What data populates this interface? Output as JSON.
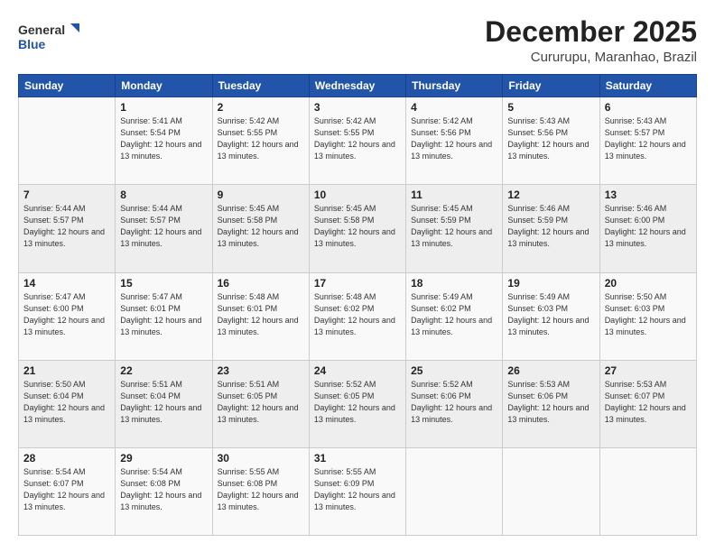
{
  "logo": {
    "line1": "General",
    "line2": "Blue"
  },
  "title": "December 2025",
  "location": "Cururupu, Maranhao, Brazil",
  "weekdays": [
    "Sunday",
    "Monday",
    "Tuesday",
    "Wednesday",
    "Thursday",
    "Friday",
    "Saturday"
  ],
  "weeks": [
    [
      {
        "day": "",
        "info": ""
      },
      {
        "day": "1",
        "info": "Sunrise: 5:41 AM\nSunset: 5:54 PM\nDaylight: 12 hours\nand 13 minutes."
      },
      {
        "day": "2",
        "info": "Sunrise: 5:42 AM\nSunset: 5:55 PM\nDaylight: 12 hours\nand 13 minutes."
      },
      {
        "day": "3",
        "info": "Sunrise: 5:42 AM\nSunset: 5:55 PM\nDaylight: 12 hours\nand 13 minutes."
      },
      {
        "day": "4",
        "info": "Sunrise: 5:42 AM\nSunset: 5:56 PM\nDaylight: 12 hours\nand 13 minutes."
      },
      {
        "day": "5",
        "info": "Sunrise: 5:43 AM\nSunset: 5:56 PM\nDaylight: 12 hours\nand 13 minutes."
      },
      {
        "day": "6",
        "info": "Sunrise: 5:43 AM\nSunset: 5:57 PM\nDaylight: 12 hours\nand 13 minutes."
      }
    ],
    [
      {
        "day": "7",
        "info": "Sunrise: 5:44 AM\nSunset: 5:57 PM\nDaylight: 12 hours\nand 13 minutes."
      },
      {
        "day": "8",
        "info": "Sunrise: 5:44 AM\nSunset: 5:57 PM\nDaylight: 12 hours\nand 13 minutes."
      },
      {
        "day": "9",
        "info": "Sunrise: 5:45 AM\nSunset: 5:58 PM\nDaylight: 12 hours\nand 13 minutes."
      },
      {
        "day": "10",
        "info": "Sunrise: 5:45 AM\nSunset: 5:58 PM\nDaylight: 12 hours\nand 13 minutes."
      },
      {
        "day": "11",
        "info": "Sunrise: 5:45 AM\nSunset: 5:59 PM\nDaylight: 12 hours\nand 13 minutes."
      },
      {
        "day": "12",
        "info": "Sunrise: 5:46 AM\nSunset: 5:59 PM\nDaylight: 12 hours\nand 13 minutes."
      },
      {
        "day": "13",
        "info": "Sunrise: 5:46 AM\nSunset: 6:00 PM\nDaylight: 12 hours\nand 13 minutes."
      }
    ],
    [
      {
        "day": "14",
        "info": "Sunrise: 5:47 AM\nSunset: 6:00 PM\nDaylight: 12 hours\nand 13 minutes."
      },
      {
        "day": "15",
        "info": "Sunrise: 5:47 AM\nSunset: 6:01 PM\nDaylight: 12 hours\nand 13 minutes."
      },
      {
        "day": "16",
        "info": "Sunrise: 5:48 AM\nSunset: 6:01 PM\nDaylight: 12 hours\nand 13 minutes."
      },
      {
        "day": "17",
        "info": "Sunrise: 5:48 AM\nSunset: 6:02 PM\nDaylight: 12 hours\nand 13 minutes."
      },
      {
        "day": "18",
        "info": "Sunrise: 5:49 AM\nSunset: 6:02 PM\nDaylight: 12 hours\nand 13 minutes."
      },
      {
        "day": "19",
        "info": "Sunrise: 5:49 AM\nSunset: 6:03 PM\nDaylight: 12 hours\nand 13 minutes."
      },
      {
        "day": "20",
        "info": "Sunrise: 5:50 AM\nSunset: 6:03 PM\nDaylight: 12 hours\nand 13 minutes."
      }
    ],
    [
      {
        "day": "21",
        "info": "Sunrise: 5:50 AM\nSunset: 6:04 PM\nDaylight: 12 hours\nand 13 minutes."
      },
      {
        "day": "22",
        "info": "Sunrise: 5:51 AM\nSunset: 6:04 PM\nDaylight: 12 hours\nand 13 minutes."
      },
      {
        "day": "23",
        "info": "Sunrise: 5:51 AM\nSunset: 6:05 PM\nDaylight: 12 hours\nand 13 minutes."
      },
      {
        "day": "24",
        "info": "Sunrise: 5:52 AM\nSunset: 6:05 PM\nDaylight: 12 hours\nand 13 minutes."
      },
      {
        "day": "25",
        "info": "Sunrise: 5:52 AM\nSunset: 6:06 PM\nDaylight: 12 hours\nand 13 minutes."
      },
      {
        "day": "26",
        "info": "Sunrise: 5:53 AM\nSunset: 6:06 PM\nDaylight: 12 hours\nand 13 minutes."
      },
      {
        "day": "27",
        "info": "Sunrise: 5:53 AM\nSunset: 6:07 PM\nDaylight: 12 hours\nand 13 minutes."
      }
    ],
    [
      {
        "day": "28",
        "info": "Sunrise: 5:54 AM\nSunset: 6:07 PM\nDaylight: 12 hours\nand 13 minutes."
      },
      {
        "day": "29",
        "info": "Sunrise: 5:54 AM\nSunset: 6:08 PM\nDaylight: 12 hours\nand 13 minutes."
      },
      {
        "day": "30",
        "info": "Sunrise: 5:55 AM\nSunset: 6:08 PM\nDaylight: 12 hours\nand 13 minutes."
      },
      {
        "day": "31",
        "info": "Sunrise: 5:55 AM\nSunset: 6:09 PM\nDaylight: 12 hours\nand 13 minutes."
      },
      {
        "day": "",
        "info": ""
      },
      {
        "day": "",
        "info": ""
      },
      {
        "day": "",
        "info": ""
      }
    ]
  ]
}
